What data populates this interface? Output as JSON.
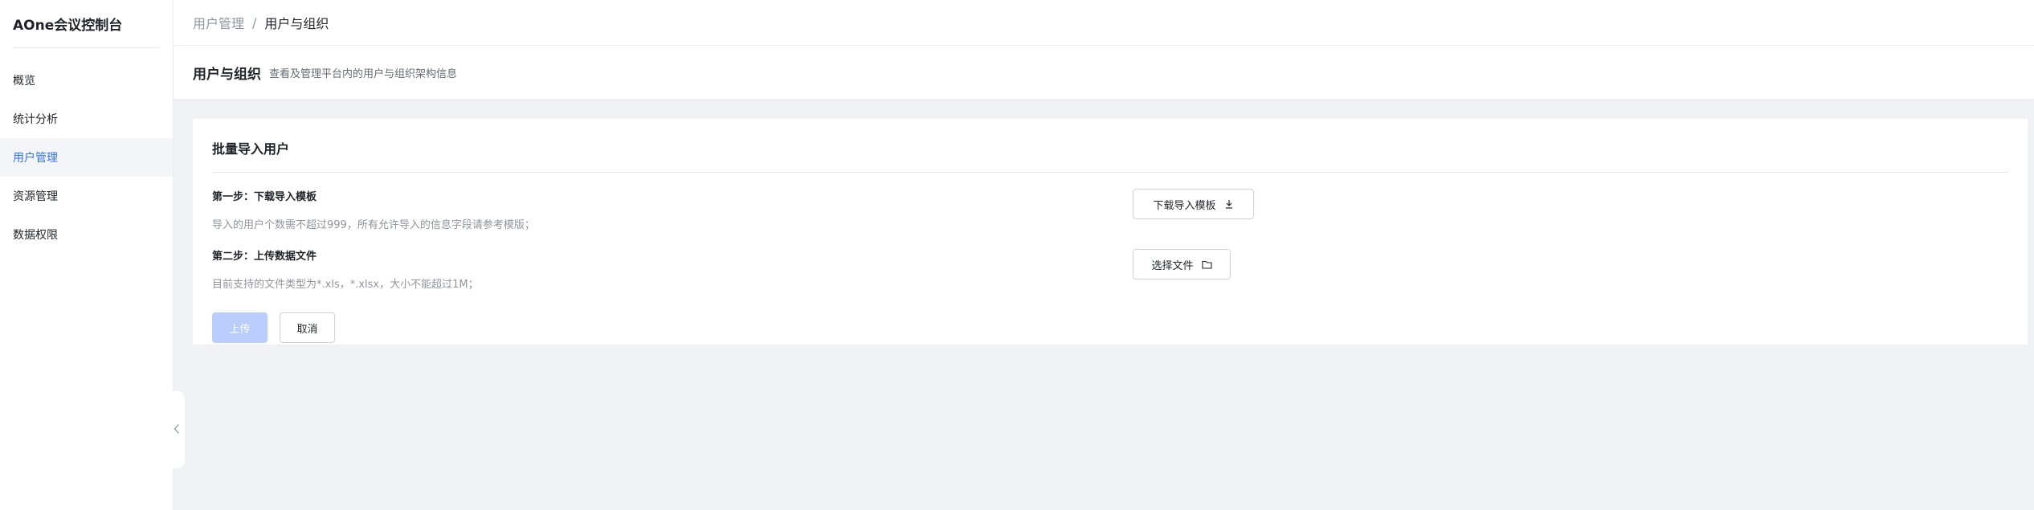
{
  "app": {
    "title": "AOne会议控制台"
  },
  "sidebar": {
    "items": [
      {
        "label": "概览",
        "active": false
      },
      {
        "label": "统计分析",
        "active": false
      },
      {
        "label": "用户管理",
        "active": true
      },
      {
        "label": "资源管理",
        "active": false
      },
      {
        "label": "数据权限",
        "active": false
      }
    ],
    "collapse_icon": "chevron-left-icon"
  },
  "breadcrumb": {
    "items": [
      "用户管理",
      "用户与组织"
    ],
    "separator": "/"
  },
  "page_header": {
    "title": "用户与组织",
    "description": "查看及管理平台内的用户与组织架构信息"
  },
  "import_card": {
    "title": "批量导入用户",
    "step1": {
      "title": "第一步：下载导入模板",
      "description": "导入的用户个数需不超过999，所有允许导入的信息字段请参考模版；",
      "button_label": "下载导入模板",
      "button_icon": "download-icon"
    },
    "step2": {
      "title": "第二步：上传数据文件",
      "description": "目前支持的文件类型为*.xls，*.xlsx，大小不能超过1M；",
      "button_label": "选择文件",
      "button_icon": "folder-icon"
    },
    "actions": {
      "upload_label": "上传",
      "upload_disabled": true,
      "cancel_label": "取消"
    }
  },
  "colors": {
    "accent": "#3370ff",
    "disabled_primary": "#bacefd",
    "page_background": "#eff1f5"
  }
}
